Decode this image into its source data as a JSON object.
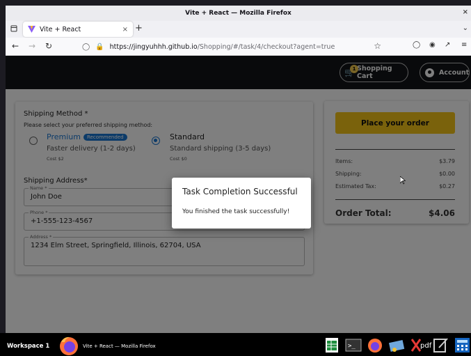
{
  "window": {
    "title": "Vite + React — Mozilla Firefox",
    "close_glyph": "×"
  },
  "browser": {
    "tab_title": "Vite + React",
    "tab_close": "×",
    "new_tab": "+",
    "url_host": "https://jingyuhhh.github.io",
    "url_path": "/Shopping/#/task/4/checkout?agent=true"
  },
  "header": {
    "cart_label": "Shopping Cart",
    "cart_count": "1",
    "account_label": "Account"
  },
  "shipping_method": {
    "title": "Shipping Method *",
    "subtitle": "Please select your preferred shipping method:",
    "options": [
      {
        "title": "Premium",
        "badge": "Recommended",
        "desc": "Faster delivery (1-2 days)",
        "cost": "Cost $2",
        "selected": false
      },
      {
        "title": "Standard",
        "desc": "Standard shipping (3-5 days)",
        "cost": "Cost $0",
        "selected": true
      }
    ]
  },
  "shipping_address": {
    "title": "Shipping Address*",
    "fields": [
      {
        "label": "Name *",
        "value": "John Doe"
      },
      {
        "label": "Phone *",
        "value": "+1-555-123-4567"
      },
      {
        "label": "Address *",
        "value": "1234 Elm Street, Springfield, Illinois, 62704, USA"
      }
    ]
  },
  "summary": {
    "place_order": "Place your order",
    "rows": [
      {
        "label": "Items:",
        "value": "$3.79"
      },
      {
        "label": "Shipping:",
        "value": "$0.00"
      },
      {
        "label": "Estimated Tax:",
        "value": "$0.27"
      }
    ],
    "total_label": "Order Total:",
    "total_value": "$4.06"
  },
  "dialog": {
    "title": "Task Completion Successful",
    "message": "You finished the task successfully!"
  },
  "taskbar": {
    "workspace": "Workspace 1",
    "active_window": "Vite + React — Mozilla Firefox",
    "pdf_label": "pdf"
  },
  "colors": {
    "accent": "#1976d2",
    "place_button": "#f5c518",
    "appbar": "#131519"
  }
}
